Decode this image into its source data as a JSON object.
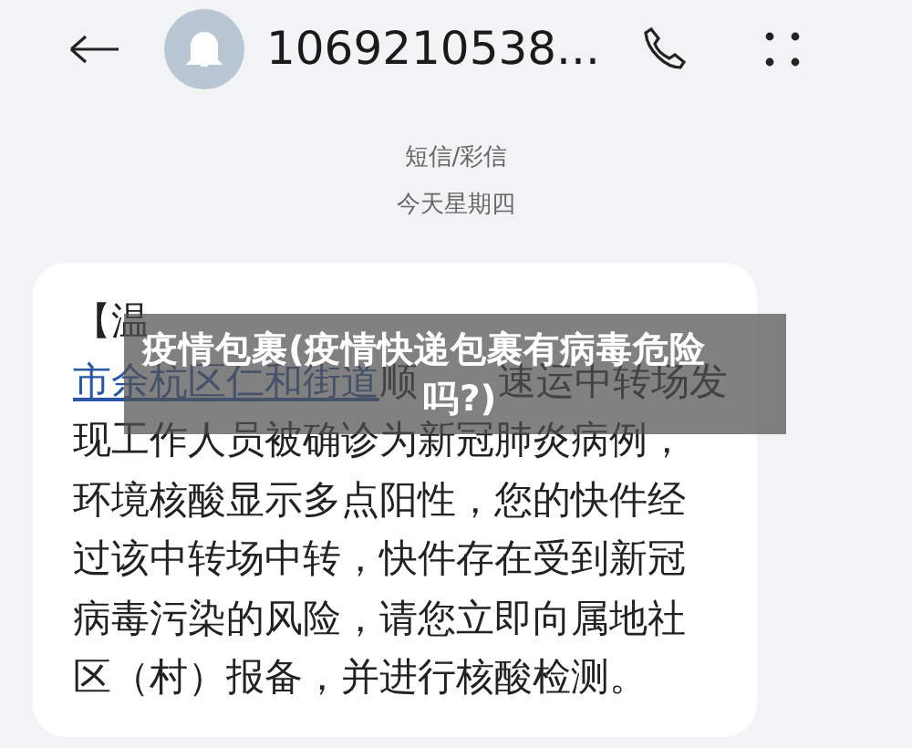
{
  "header": {
    "contact": "1069210538..."
  },
  "info": {
    "channel": "短信/彩信",
    "day": "今天星期四"
  },
  "message": {
    "lines": [
      {
        "parts": [
          {
            "kind": "text",
            "text": "【温"
          },
          {
            "kind": "gap"
          }
        ]
      },
      {
        "parts": [
          {
            "kind": "link",
            "text": "市余杭区仁和街道"
          },
          {
            "kind": "text",
            "text": "顺"
          },
          {
            "kind": "gap"
          },
          {
            "kind": "text",
            "text": "速运中转场发"
          }
        ]
      },
      {
        "parts": [
          {
            "kind": "text",
            "text": "现工作人员被确诊为新冠肺炎病例，"
          }
        ]
      },
      {
        "parts": [
          {
            "kind": "text",
            "text": "环境核酸显示多点阳性，您的快件经"
          }
        ]
      },
      {
        "parts": [
          {
            "kind": "text",
            "text": "过该中转场中转，快件存在受到新冠"
          }
        ]
      },
      {
        "parts": [
          {
            "kind": "text",
            "text": "病毒污染的风险，请您立即向属地社"
          }
        ]
      },
      {
        "parts": [
          {
            "kind": "text",
            "text": "区（村）报备，并进行核酸检测。"
          }
        ]
      }
    ]
  },
  "caption": {
    "lines": [
      "疫情包裹(疫情快递包裹有病毒危险",
      "吗?)"
    ]
  }
}
